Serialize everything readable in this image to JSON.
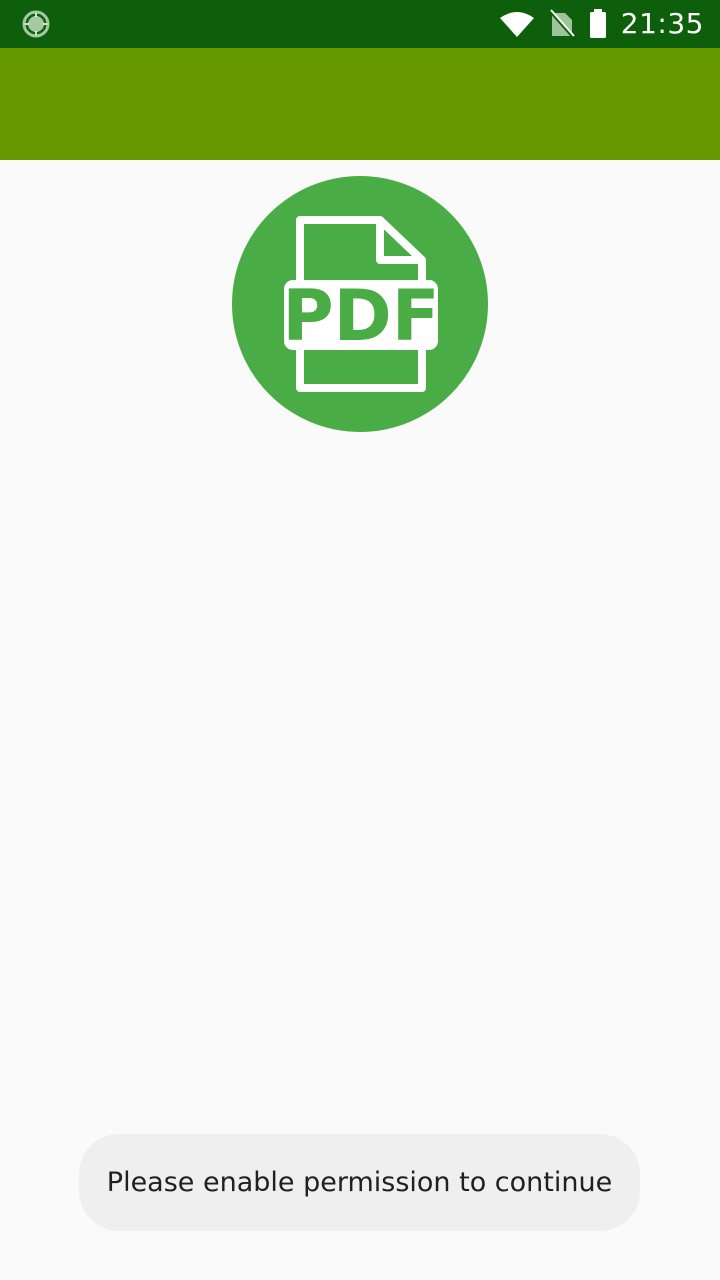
{
  "status_bar": {
    "time": "21:35",
    "icons": [
      "loading-circle-icon",
      "wifi-icon",
      "no-sim-icon",
      "battery-icon"
    ],
    "color": "#0e5f0b"
  },
  "app_bar": {
    "color": "#669900"
  },
  "logo": {
    "icon": "pdf-file-icon",
    "text": "PDF",
    "color": "#4aac45"
  },
  "toast": {
    "message": "Please enable permission to continue"
  }
}
